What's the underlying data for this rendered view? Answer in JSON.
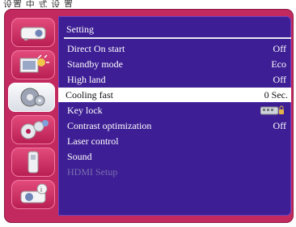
{
  "caption": "设置 中 式 设 置",
  "menu": {
    "title": "Setting",
    "items": [
      {
        "label": "Direct On start",
        "value": "Off",
        "state": "normal"
      },
      {
        "label": "Standby mode",
        "value": "Eco",
        "state": "normal"
      },
      {
        "label": "High land",
        "value": "Off",
        "state": "normal"
      },
      {
        "label": "Cooling fast",
        "value": "0 Sec.",
        "state": "selected"
      },
      {
        "label": "Key lock",
        "value": "",
        "state": "normal",
        "icon": "keylock-icon"
      },
      {
        "label": "Contrast optimization",
        "value": "Off",
        "state": "normal"
      },
      {
        "label": "Laser control",
        "value": "",
        "state": "normal"
      },
      {
        "label": "Sound",
        "value": "",
        "state": "normal"
      },
      {
        "label": "HDMI Setup",
        "value": "",
        "state": "disabled"
      }
    ]
  },
  "sidebar": {
    "tabs": [
      {
        "name": "projector-icon"
      },
      {
        "name": "image-icon"
      },
      {
        "name": "settings-gear-icon",
        "selected": true
      },
      {
        "name": "expanded-settings-gears-icon"
      },
      {
        "name": "usb-drive-icon"
      },
      {
        "name": "info-projector-icon"
      }
    ]
  },
  "colors": {
    "frame": "#c22a5f",
    "panel": "#3d1e94",
    "highlight": "#ffffff"
  }
}
